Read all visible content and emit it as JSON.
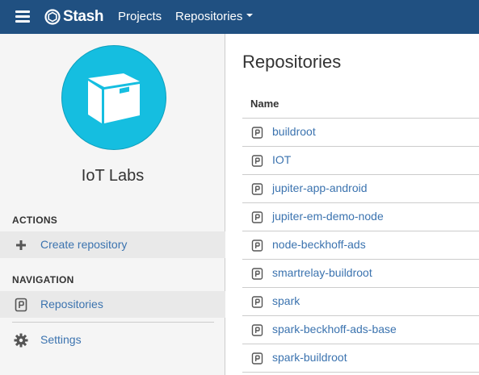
{
  "header": {
    "app_name": "Stash",
    "nav": {
      "projects_label": "Projects",
      "repositories_label": "Repositories"
    },
    "background_color": "#205081"
  },
  "sidebar": {
    "project_name": "IoT Labs",
    "avatar_color": "#15bee0",
    "actions_heading": "ACTIONS",
    "actions": [
      {
        "label": "Create repository",
        "icon": "plus-icon"
      }
    ],
    "navigation_heading": "NAVIGATION",
    "navigation": [
      {
        "label": "Repositories",
        "icon": "repository-icon",
        "active": true
      },
      {
        "label": "Settings",
        "icon": "gear-icon"
      }
    ]
  },
  "main": {
    "title": "Repositories",
    "table": {
      "header_name": "Name",
      "rows": [
        "buildroot",
        "IOT",
        "jupiter-app-android",
        "jupiter-em-demo-node",
        "node-beckhoff-ads",
        "smartrelay-buildroot",
        "spark",
        "spark-beckhoff-ads-base",
        "spark-buildroot"
      ]
    }
  },
  "colors": {
    "link": "#3b73af",
    "sidebar_bg": "#f5f5f5",
    "active_item_bg": "#e9e9e9"
  }
}
